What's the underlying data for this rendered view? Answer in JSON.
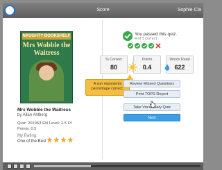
{
  "header": {
    "title": "Score",
    "user": "Sophie Cla"
  },
  "book": {
    "cover_series": "NAUGHTY BOOKSHELF",
    "cover_title": "Mrs Wobble the Waitress",
    "title": "Mrs Wobble the Waitress",
    "author": "by Allan Ahlberg",
    "quiz_line": "Quiz: 201963 EN   Level: 2.5 LY",
    "points_line": "Points: 0.5",
    "rating_label": "My Rating:",
    "rating_value": "One of the Best",
    "rating_stars": 4
  },
  "result": {
    "title": "You passed this quiz.",
    "subtitle": "4 of 5 correct",
    "answers": [
      "correct",
      "correct",
      "correct",
      "correct",
      "wrong"
    ]
  },
  "stats": [
    {
      "label": "% Correct",
      "value": "80"
    },
    {
      "label": "Points",
      "value": "0.4"
    },
    {
      "label": "Words Read",
      "value": "622"
    }
  ],
  "tooltip": {
    "line1": "A sun represents",
    "line2": "percentage correct."
  },
  "buttons": {
    "review": "Review Missed Questions",
    "tops": "Print TOPS Report",
    "vocab": "Take Vocabulary Quiz",
    "next": "Next"
  },
  "player": {
    "progress": 0.34
  },
  "colors": {
    "accent": "#3b9ee6",
    "pass": "#3aa84a",
    "tooltip": "#f5be3e",
    "star": "#f4a62a"
  }
}
